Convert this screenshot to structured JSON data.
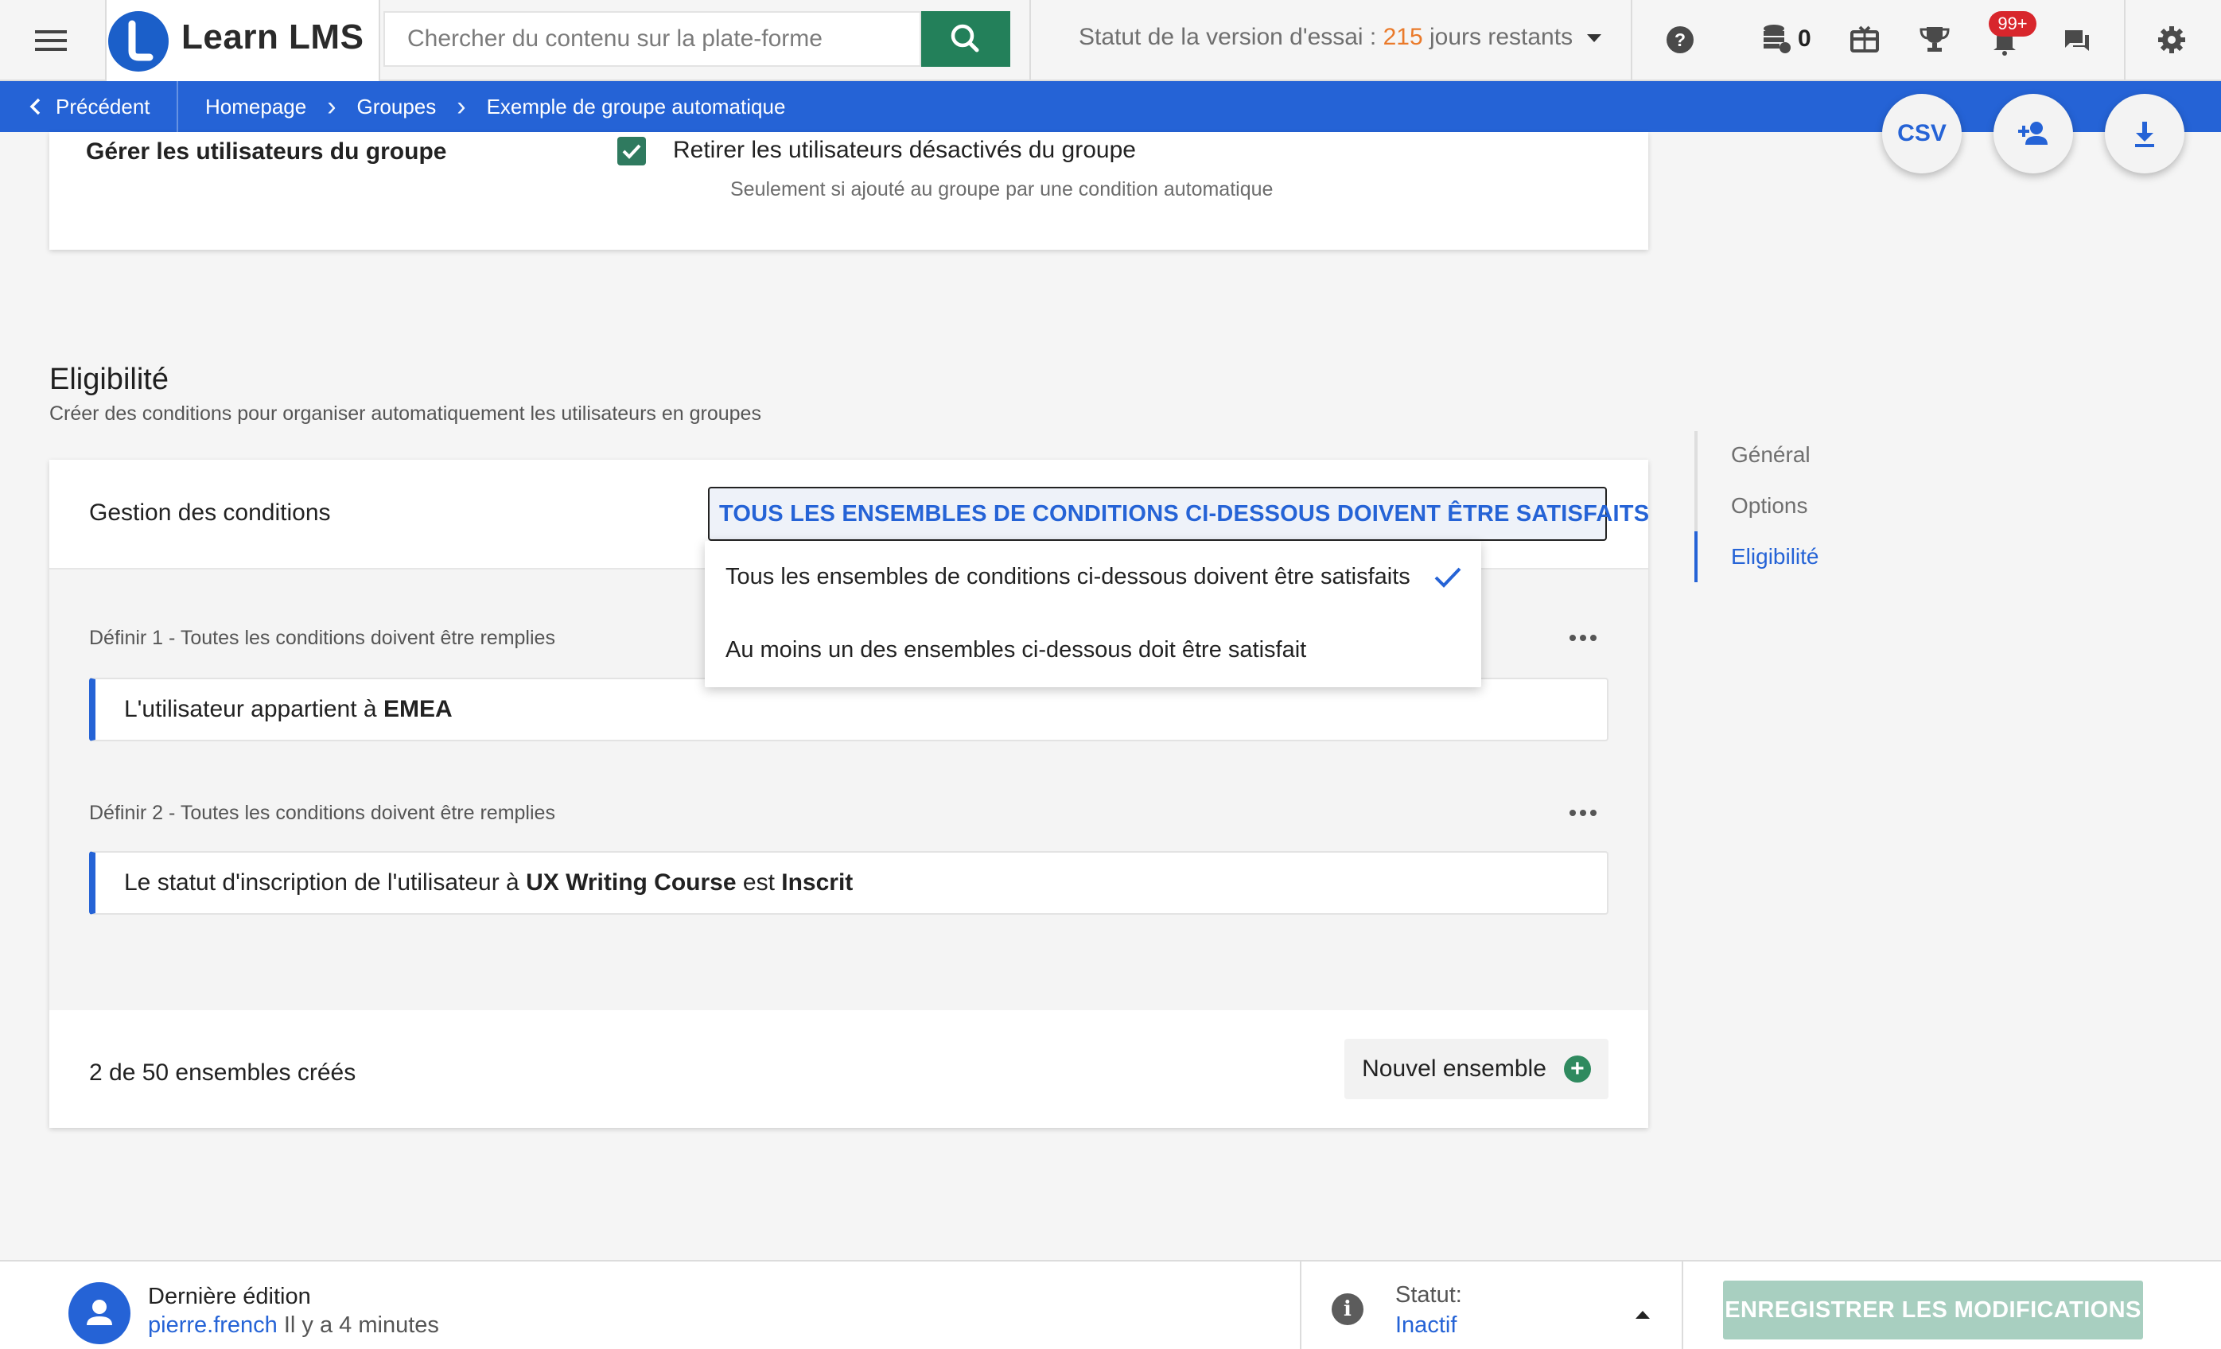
{
  "app": {
    "name": "Learn LMS"
  },
  "search": {
    "placeholder": "Chercher du contenu sur la plate-forme"
  },
  "trial": {
    "prefix": "Statut de la version d'essai : ",
    "days": "215",
    "suffix": " jours restants"
  },
  "header": {
    "credits": "0",
    "notifications_badge": "99+"
  },
  "breadcrumb": {
    "back_label": "Précédent",
    "items": [
      "Homepage",
      "Groupes",
      "Exemple de groupe automatique"
    ]
  },
  "fabs": {
    "csv_label": "CSV"
  },
  "manage_users": {
    "label": "Gérer les utilisateurs du groupe",
    "checkbox_label": "Retirer les utilisateurs désactivés du groupe",
    "checkbox_checked": true,
    "hint": "Seulement si ajouté au groupe par une condition automatique"
  },
  "eligibility": {
    "title": "Eligibilité",
    "subtitle": "Créer des conditions pour organiser automatiquement les utilisateurs en groupes",
    "condition_management_label": "Gestion des conditions",
    "selected_option": "TOUS LES ENSEMBLES DE CONDITIONS CI-DESSOUS DOIVENT ÊTRE SATISFAITS",
    "options": [
      "Tous les ensembles de conditions ci-dessous doivent être satisfaits",
      "Au moins un des ensembles ci-dessous doit être satisfait"
    ],
    "sets": [
      {
        "header": "Définir 1 - Toutes les conditions doivent être remplies",
        "condition": {
          "text1": "L'utilisateur appartient à ",
          "bold1": "EMEA"
        }
      },
      {
        "header": "Définir 2 - Toutes les conditions doivent être remplies",
        "condition": {
          "text1": "Le statut d'inscription de l'utilisateur à ",
          "bold1": "UX Writing Course",
          "text2": " est ",
          "bold2": "Inscrit"
        }
      }
    ],
    "sets_count": "2 de 50 ensembles créés",
    "new_set_label": "Nouvel ensemble"
  },
  "side_nav": {
    "items": [
      "Général",
      "Options",
      "Eligibilité"
    ],
    "active": "Eligibilité"
  },
  "footer": {
    "last_edit_label": "Dernière édition",
    "last_edit_user": "pierre.french",
    "last_edit_time": " Il y a 4 minutes",
    "status_label": "Statut:",
    "status_value": "Inactif",
    "save_label": "ENREGISTRER LES MODIFICATIONS"
  },
  "colors": {
    "brand_blue": "#2563d6",
    "search_green": "#23805a",
    "trial_orange": "#ea7a2a",
    "badge_red": "#d8262c",
    "save_disabled": "#a8cfc0"
  }
}
